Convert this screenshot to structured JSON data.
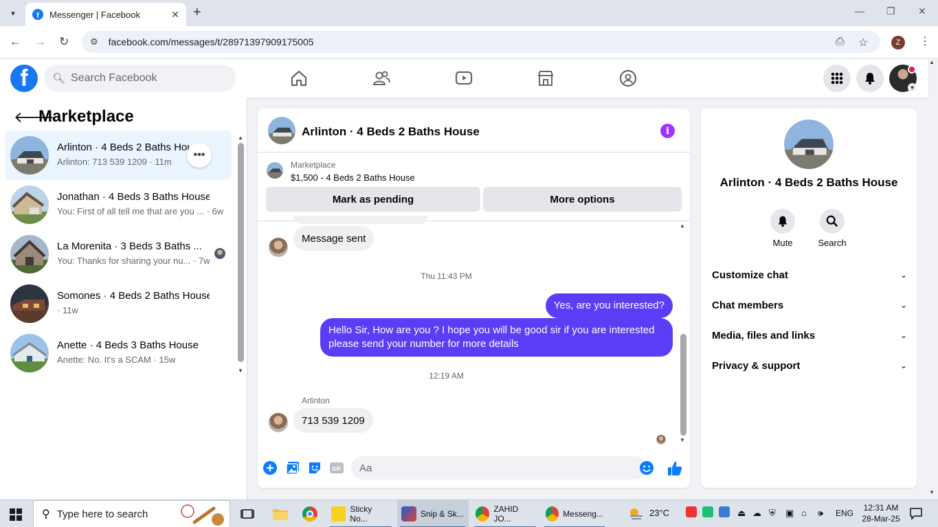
{
  "browser": {
    "tab_title": "Messenger | Facebook",
    "url": "facebook.com/messages/t/28971397909175005",
    "profile_initial": "Z"
  },
  "fb": {
    "search_placeholder": "Search Facebook"
  },
  "sidebar": {
    "title": "Marketplace",
    "conversations": [
      {
        "name": "Arlinton · 4 Beds 2 Baths House",
        "preview": "Arlinton: 713 539 1209 · 11m",
        "active": true
      },
      {
        "name": "Jonathan · 4 Beds 3 Baths House",
        "preview": "You: First of all tell me that are you ... · 6w"
      },
      {
        "name": "La Morenita · 3 Beds 3 Baths ...",
        "preview": "You: Thanks for sharing your nu... · 7w"
      },
      {
        "name": "Somones · 4 Beds 2 Baths House",
        "preview": "· 11w"
      },
      {
        "name": "Anette · 4 Beds 3 Baths House",
        "preview": "Anette: No. It's a SCAM · 15w"
      }
    ]
  },
  "chat": {
    "title": "Arlinton · 4 Beds 2 Baths House",
    "banner_label": "Marketplace",
    "banner_price": "$1,500 - 4 Beds 2 Baths House",
    "btn_pending": "Mark as pending",
    "btn_more": "More options",
    "messages": {
      "sent_notice": "Message sent",
      "stamp1": "Thu 11:43 PM",
      "out1": "Yes, are you interested?",
      "out2": "Hello Sir, How are you ? I hope you will be good sir if you are interested please send your number for more details",
      "stamp2": "12:19 AM",
      "sender": "Arlinton",
      "in1": "713 539 1209"
    },
    "input_placeholder": "Aa"
  },
  "right_panel": {
    "title": "Arlinton · 4 Beds 2 Baths House",
    "mute": "Mute",
    "search": "Search",
    "rows": [
      "Customize chat",
      "Chat members",
      "Media, files and links",
      "Privacy & support"
    ]
  },
  "taskbar": {
    "search_placeholder": "Type here to search",
    "apps": [
      "Sticky No...",
      "Snip & Sk...",
      "ZAHID JO...",
      "Messeng..."
    ],
    "weather": "23°C",
    "lang": "ENG",
    "time": "12:31 AM",
    "date": "28-Mar-25"
  }
}
